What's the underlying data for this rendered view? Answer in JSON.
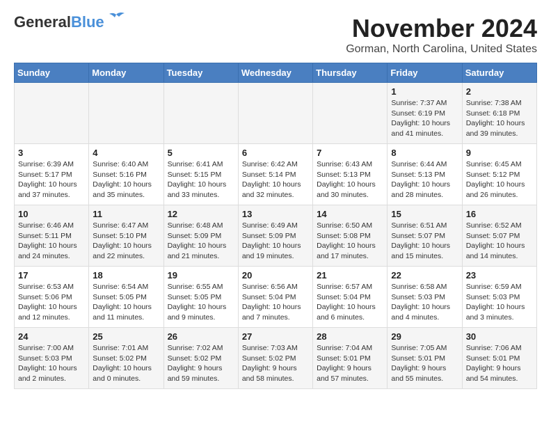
{
  "header": {
    "logo_line1": "General",
    "logo_line2": "Blue",
    "month": "November 2024",
    "location": "Gorman, North Carolina, United States"
  },
  "days_of_week": [
    "Sunday",
    "Monday",
    "Tuesday",
    "Wednesday",
    "Thursday",
    "Friday",
    "Saturday"
  ],
  "weeks": [
    [
      {
        "day": "",
        "info": ""
      },
      {
        "day": "",
        "info": ""
      },
      {
        "day": "",
        "info": ""
      },
      {
        "day": "",
        "info": ""
      },
      {
        "day": "",
        "info": ""
      },
      {
        "day": "1",
        "info": "Sunrise: 7:37 AM\nSunset: 6:19 PM\nDaylight: 10 hours\nand 41 minutes."
      },
      {
        "day": "2",
        "info": "Sunrise: 7:38 AM\nSunset: 6:18 PM\nDaylight: 10 hours\nand 39 minutes."
      }
    ],
    [
      {
        "day": "3",
        "info": "Sunrise: 6:39 AM\nSunset: 5:17 PM\nDaylight: 10 hours\nand 37 minutes."
      },
      {
        "day": "4",
        "info": "Sunrise: 6:40 AM\nSunset: 5:16 PM\nDaylight: 10 hours\nand 35 minutes."
      },
      {
        "day": "5",
        "info": "Sunrise: 6:41 AM\nSunset: 5:15 PM\nDaylight: 10 hours\nand 33 minutes."
      },
      {
        "day": "6",
        "info": "Sunrise: 6:42 AM\nSunset: 5:14 PM\nDaylight: 10 hours\nand 32 minutes."
      },
      {
        "day": "7",
        "info": "Sunrise: 6:43 AM\nSunset: 5:13 PM\nDaylight: 10 hours\nand 30 minutes."
      },
      {
        "day": "8",
        "info": "Sunrise: 6:44 AM\nSunset: 5:13 PM\nDaylight: 10 hours\nand 28 minutes."
      },
      {
        "day": "9",
        "info": "Sunrise: 6:45 AM\nSunset: 5:12 PM\nDaylight: 10 hours\nand 26 minutes."
      }
    ],
    [
      {
        "day": "10",
        "info": "Sunrise: 6:46 AM\nSunset: 5:11 PM\nDaylight: 10 hours\nand 24 minutes."
      },
      {
        "day": "11",
        "info": "Sunrise: 6:47 AM\nSunset: 5:10 PM\nDaylight: 10 hours\nand 22 minutes."
      },
      {
        "day": "12",
        "info": "Sunrise: 6:48 AM\nSunset: 5:09 PM\nDaylight: 10 hours\nand 21 minutes."
      },
      {
        "day": "13",
        "info": "Sunrise: 6:49 AM\nSunset: 5:09 PM\nDaylight: 10 hours\nand 19 minutes."
      },
      {
        "day": "14",
        "info": "Sunrise: 6:50 AM\nSunset: 5:08 PM\nDaylight: 10 hours\nand 17 minutes."
      },
      {
        "day": "15",
        "info": "Sunrise: 6:51 AM\nSunset: 5:07 PM\nDaylight: 10 hours\nand 15 minutes."
      },
      {
        "day": "16",
        "info": "Sunrise: 6:52 AM\nSunset: 5:07 PM\nDaylight: 10 hours\nand 14 minutes."
      }
    ],
    [
      {
        "day": "17",
        "info": "Sunrise: 6:53 AM\nSunset: 5:06 PM\nDaylight: 10 hours\nand 12 minutes."
      },
      {
        "day": "18",
        "info": "Sunrise: 6:54 AM\nSunset: 5:05 PM\nDaylight: 10 hours\nand 11 minutes."
      },
      {
        "day": "19",
        "info": "Sunrise: 6:55 AM\nSunset: 5:05 PM\nDaylight: 10 hours\nand 9 minutes."
      },
      {
        "day": "20",
        "info": "Sunrise: 6:56 AM\nSunset: 5:04 PM\nDaylight: 10 hours\nand 7 minutes."
      },
      {
        "day": "21",
        "info": "Sunrise: 6:57 AM\nSunset: 5:04 PM\nDaylight: 10 hours\nand 6 minutes."
      },
      {
        "day": "22",
        "info": "Sunrise: 6:58 AM\nSunset: 5:03 PM\nDaylight: 10 hours\nand 4 minutes."
      },
      {
        "day": "23",
        "info": "Sunrise: 6:59 AM\nSunset: 5:03 PM\nDaylight: 10 hours\nand 3 minutes."
      }
    ],
    [
      {
        "day": "24",
        "info": "Sunrise: 7:00 AM\nSunset: 5:03 PM\nDaylight: 10 hours\nand 2 minutes."
      },
      {
        "day": "25",
        "info": "Sunrise: 7:01 AM\nSunset: 5:02 PM\nDaylight: 10 hours\nand 0 minutes."
      },
      {
        "day": "26",
        "info": "Sunrise: 7:02 AM\nSunset: 5:02 PM\nDaylight: 9 hours\nand 59 minutes."
      },
      {
        "day": "27",
        "info": "Sunrise: 7:03 AM\nSunset: 5:02 PM\nDaylight: 9 hours\nand 58 minutes."
      },
      {
        "day": "28",
        "info": "Sunrise: 7:04 AM\nSunset: 5:01 PM\nDaylight: 9 hours\nand 57 minutes."
      },
      {
        "day": "29",
        "info": "Sunrise: 7:05 AM\nSunset: 5:01 PM\nDaylight: 9 hours\nand 55 minutes."
      },
      {
        "day": "30",
        "info": "Sunrise: 7:06 AM\nSunset: 5:01 PM\nDaylight: 9 hours\nand 54 minutes."
      }
    ]
  ]
}
